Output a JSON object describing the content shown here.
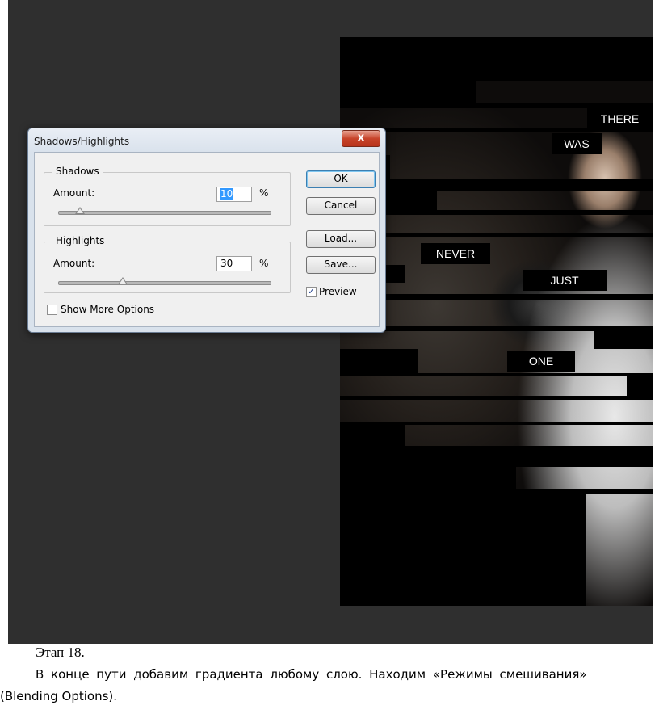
{
  "dialog": {
    "title": "Shadows/Highlights",
    "close_label": "x",
    "shadows": {
      "group_label": "Shadows",
      "amount_label": "Amount:",
      "amount_value": "10",
      "unit": "%",
      "slider_value_percent": 10
    },
    "highlights": {
      "group_label": "Highlights",
      "amount_label": "Amount:",
      "amount_value": "30",
      "unit": "%",
      "slider_value_percent": 30
    },
    "show_more_options": {
      "label": "Show More Options",
      "checked": false
    },
    "buttons": {
      "ok": "OK",
      "cancel": "Cancel",
      "load": "Load...",
      "save": "Save..."
    },
    "preview": {
      "label": "Preview",
      "checked": true,
      "check_glyph": "✓"
    }
  },
  "poster": {
    "words": [
      "THERE",
      "WAS",
      "NEVER",
      "JUST",
      "ONE"
    ]
  },
  "document": {
    "step": "Этап 18.",
    "paragraph_line1": "В конце пути добавим градиента любому слою. Находим «Режимы смешивания»",
    "paragraph_line2": "(Blending Options)."
  },
  "colors": {
    "workspace": "#2f2f2f",
    "canvas": "#000000",
    "dialog_frame": "#d9e2ec",
    "close_button": "#c7442a",
    "selection": "#3399ff"
  }
}
